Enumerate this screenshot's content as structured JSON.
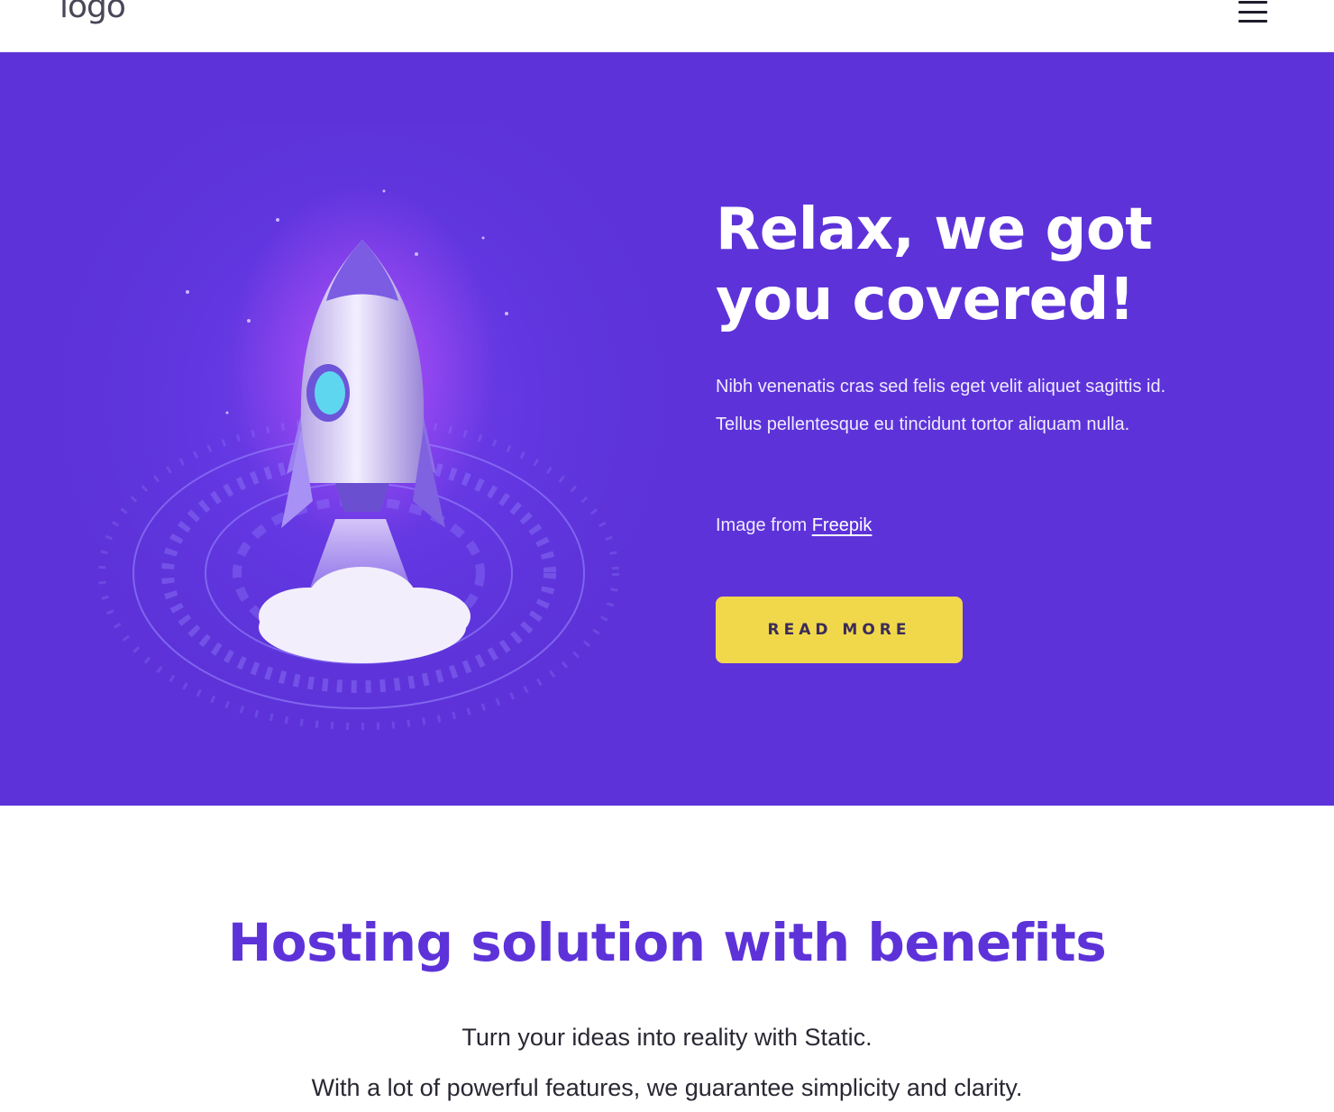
{
  "header": {
    "logo_text": "logo",
    "menu_icon": "hamburger-menu-icon"
  },
  "hero": {
    "title": "Relax, we got you covered!",
    "text": "Nibh venenatis cras sed felis eget velit aliquet sagittis id. Tellus pellentesque eu tincidunt tortor aliquam nulla.",
    "credit_prefix": "Image from ",
    "credit_link": "Freepik",
    "button_label": "READ MORE",
    "image": "rocket-launch-illustration"
  },
  "benefits": {
    "title": "Hosting solution with benefits",
    "line1": "Turn your ideas into reality with Static.",
    "line2": "With a lot of powerful features, we guarantee simplicity and clarity."
  },
  "colors": {
    "hero_bg": "#5d33d9",
    "button_bg": "#f1d84b",
    "heading_purple": "#5d33d9"
  }
}
